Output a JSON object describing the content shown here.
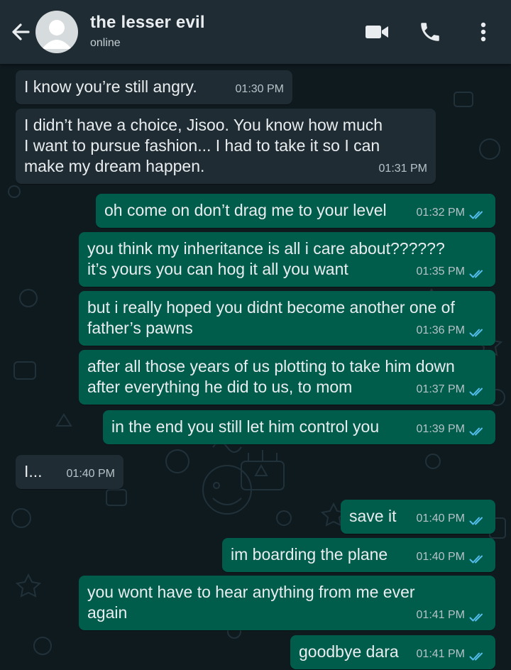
{
  "contact": {
    "name": "the lesser evil",
    "status": "online"
  },
  "colors": {
    "header": "#1f2c34",
    "incoming": "#1f2c34",
    "outgoing": "#005c4b",
    "read_ticks": "#53bdeb"
  },
  "icons": {
    "back": "arrow-left-icon",
    "avatar": "default-avatar-icon",
    "video": "video-camera-icon",
    "call": "phone-icon",
    "menu": "more-vertical-icon",
    "read": "double-check-icon"
  },
  "messages": [
    {
      "direction": "in",
      "text": "I know you’re still angry.",
      "time": "01:30 PM"
    },
    {
      "direction": "in",
      "text": "I didn’t have a choice, Jisoo. You know how much\nI want to pursue fashion... I had to take it so I can\nmake my dream happen.",
      "time": "01:31 PM"
    },
    {
      "direction": "out",
      "text": "oh come on don’t drag me to your level",
      "time": "01:32 PM"
    },
    {
      "direction": "out",
      "text": "you think my inheritance is all i care about??????\nit’s yours you can hog it all you want",
      "time": "01:35 PM"
    },
    {
      "direction": "out",
      "text": "but i really hoped you didnt become another one of\nfather’s pawns",
      "time": "01:36 PM"
    },
    {
      "direction": "out",
      "text": "after all those years of us plotting to take him down\nafter everything he did to us, to mom",
      "time": "01:37 PM"
    },
    {
      "direction": "out",
      "text": "in the end you still let him control you",
      "time": "01:39 PM"
    },
    {
      "direction": "in",
      "text": "I...",
      "time": "01:40 PM"
    },
    {
      "direction": "out",
      "text": "save it",
      "time": "01:40 PM"
    },
    {
      "direction": "out",
      "text": "im boarding the plane",
      "time": "01:40 PM"
    },
    {
      "direction": "out",
      "text": "you wont have to hear anything from me ever\nagain",
      "time": "01:41 PM"
    },
    {
      "direction": "out",
      "text": "goodbye dara",
      "time": "01:41 PM"
    }
  ]
}
